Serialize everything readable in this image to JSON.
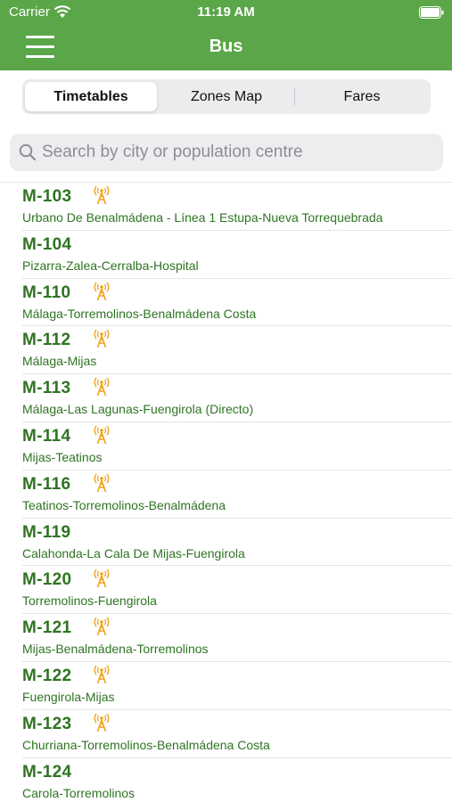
{
  "status_bar": {
    "carrier": "Carrier",
    "time": "11:19 AM"
  },
  "header": {
    "title": "Bus",
    "color": "#5aa648"
  },
  "tabs": [
    {
      "label": "Timetables",
      "active": true
    },
    {
      "label": "Zones Map",
      "active": false
    },
    {
      "label": "Fares",
      "active": false
    }
  ],
  "search": {
    "placeholder": "Search by city or population centre",
    "value": ""
  },
  "routes": [
    {
      "code": "M-103",
      "desc": "Urbano De Benalmádena - Línea 1 Estupa-Nueva Torrequebrada",
      "live": true
    },
    {
      "code": "M-104",
      "desc": "Pizarra-Zalea-Cerralba-Hospital",
      "live": false
    },
    {
      "code": "M-110",
      "desc": "Málaga-Torremolinos-Benalmádena Costa",
      "live": true
    },
    {
      "code": "M-112",
      "desc": "Málaga-Mijas",
      "live": true
    },
    {
      "code": "M-113",
      "desc": "Málaga-Las Lagunas-Fuengirola (Directo)",
      "live": true
    },
    {
      "code": "M-114",
      "desc": "Mijas-Teatinos",
      "live": true
    },
    {
      "code": "M-116",
      "desc": "Teatinos-Torremolinos-Benalmádena",
      "live": true
    },
    {
      "code": "M-119",
      "desc": "Calahonda-La Cala De Mijas-Fuengirola",
      "live": false
    },
    {
      "code": "M-120",
      "desc": "Torremolinos-Fuengirola",
      "live": true
    },
    {
      "code": "M-121",
      "desc": "Mijas-Benalmádena-Torremolinos",
      "live": true
    },
    {
      "code": "M-122",
      "desc": "Fuengirola-Mijas",
      "live": true
    },
    {
      "code": "M-123",
      "desc": "Churriana-Torremolinos-Benalmádena Costa",
      "live": true
    },
    {
      "code": "M-124",
      "desc": "Carola-Torremolinos",
      "live": false
    }
  ],
  "colors": {
    "route_text": "#2e7422",
    "live_icon": "#f0a21c"
  }
}
